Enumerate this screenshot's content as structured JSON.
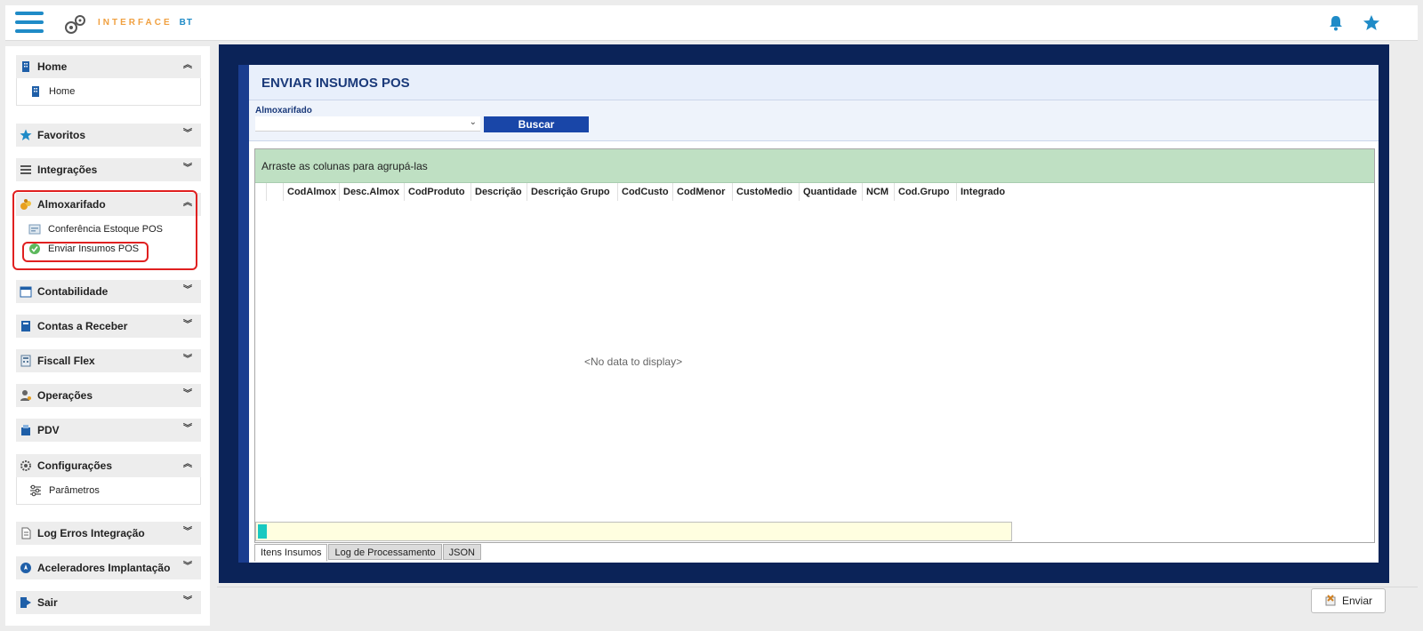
{
  "app": {
    "logo_text": "INTERFACE",
    "logo_suffix": "BT"
  },
  "sidebar": {
    "groups": [
      {
        "label": "Home",
        "icon": "building-icon",
        "expanded": true,
        "items": [
          {
            "label": "Home",
            "icon": "building-icon"
          }
        ]
      },
      {
        "label": "Favoritos",
        "icon": "star-icon",
        "expanded": false
      },
      {
        "label": "Integrações",
        "icon": "list-icon",
        "expanded": false
      },
      {
        "label": "Almoxarifado",
        "icon": "warehouse-icon",
        "expanded": true,
        "items": [
          {
            "label": "Conferência Estoque POS",
            "icon": "inventory-icon"
          },
          {
            "label": "Enviar Insumos POS",
            "icon": "check-circle-icon"
          }
        ]
      },
      {
        "label": "Contabilidade",
        "icon": "calendar-icon",
        "expanded": false
      },
      {
        "label": "Contas a Receber",
        "icon": "ledger-icon",
        "expanded": false
      },
      {
        "label": "Fiscall Flex",
        "icon": "calculator-icon",
        "expanded": false
      },
      {
        "label": "Operações",
        "icon": "user-gear-icon",
        "expanded": false
      },
      {
        "label": "PDV",
        "icon": "pos-icon",
        "expanded": false
      },
      {
        "label": "Configurações",
        "icon": "gear-icon",
        "expanded": true,
        "items": [
          {
            "label": "Parâmetros",
            "icon": "sliders-icon"
          }
        ]
      },
      {
        "label": "Log Erros Integração",
        "icon": "document-icon",
        "expanded": false
      },
      {
        "label": "Aceleradores Implantação",
        "icon": "rocket-icon",
        "expanded": false
      },
      {
        "label": "Sair",
        "icon": "exit-icon",
        "expanded": false
      }
    ]
  },
  "page": {
    "title": "ENVIAR INSUMOS POS",
    "filter_label": "Almoxarifado",
    "filter_value": "",
    "search_button": "Buscar"
  },
  "grid": {
    "group_panel_text": "Arraste as colunas para agrupá-las",
    "columns": [
      "CodAlmox",
      "Desc.Almox",
      "CodProduto",
      "Descrição",
      "Descrição Grupo",
      "CodCusto",
      "CodMenor",
      "CustoMedio",
      "Quantidade",
      "NCM",
      "Cod.Grupo",
      "Integrado"
    ],
    "empty_text": "<No data to display>"
  },
  "tabs": [
    "Itens Insumos",
    "Log de Processamento",
    "JSON"
  ],
  "actions": {
    "send_button": "Enviar"
  },
  "colors": {
    "accent_blue": "#1946a8",
    "frame_navy": "#0b2358",
    "group_panel_green": "#bfe0c3",
    "highlight_red": "#e02020"
  }
}
